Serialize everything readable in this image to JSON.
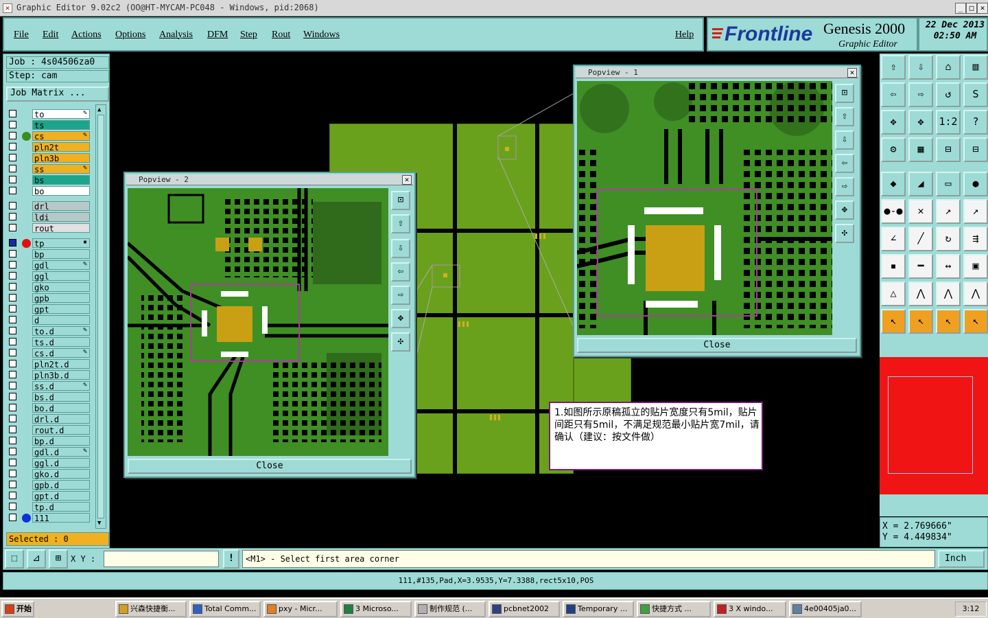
{
  "window": {
    "title": "Graphic Editor 9.02c2 (OO@HT-MYCAM-PC048 - Windows, pid:2068)"
  },
  "menu": {
    "items": [
      "File",
      "Edit",
      "Actions",
      "Options",
      "Analysis",
      "DFM",
      "Step",
      "Rout",
      "Windows"
    ],
    "help": "Help"
  },
  "brand": {
    "logo": "Frontline",
    "product": "Genesis 2000",
    "subtitle": "Graphic Editor"
  },
  "datetime": {
    "date": "22 Dec 2013",
    "time": "02:50 AM"
  },
  "job": {
    "job": "Job : 4s04506za0",
    "step": "Step: cam",
    "matrix_button": "Job Matrix ..."
  },
  "layers": [
    {
      "name": "to",
      "color": "#ffffff",
      "mark": "✎"
    },
    {
      "name": "ts",
      "color": "#1aa58c",
      "mark": ""
    },
    {
      "name": "cs",
      "color": "#f0b020",
      "mark": "✎",
      "dot": "#3c8c1c"
    },
    {
      "name": "pln2t",
      "color": "#f0b020",
      "mark": ""
    },
    {
      "name": "pln3b",
      "color": "#f0b020",
      "mark": ""
    },
    {
      "name": "ss",
      "color": "#f0b020",
      "mark": "✎"
    },
    {
      "name": "bs",
      "color": "#1aa58c",
      "mark": ""
    },
    {
      "name": "bo",
      "color": "#ffffff",
      "mark": ""
    },
    {
      "name": "drl",
      "color": "#b8c8c8",
      "mark": "",
      "gap": true
    },
    {
      "name": "ldi",
      "color": "#b8c8c8",
      "mark": ""
    },
    {
      "name": "rout",
      "color": "#e0e0e0",
      "mark": ""
    },
    {
      "name": "tp",
      "color": "#9edbd6",
      "mark": "▪",
      "gap": true,
      "dot": "#e01010",
      "checked": true
    },
    {
      "name": "bp",
      "color": "#9edbd6",
      "mark": ""
    },
    {
      "name": "gdl",
      "color": "#9edbd6",
      "mark": "✎"
    },
    {
      "name": "ggl",
      "color": "#9edbd6",
      "mark": ""
    },
    {
      "name": "gko",
      "color": "#9edbd6",
      "mark": ""
    },
    {
      "name": "gpb",
      "color": "#9edbd6",
      "mark": ""
    },
    {
      "name": "gpt",
      "color": "#9edbd6",
      "mark": ""
    },
    {
      "name": "d",
      "color": "#9edbd6",
      "mark": ""
    },
    {
      "name": "to.d",
      "color": "#9edbd6",
      "mark": "✎"
    },
    {
      "name": "ts.d",
      "color": "#9edbd6",
      "mark": ""
    },
    {
      "name": "cs.d",
      "color": "#9edbd6",
      "mark": "✎"
    },
    {
      "name": "pln2t.d",
      "color": "#9edbd6",
      "mark": ""
    },
    {
      "name": "pln3b.d",
      "color": "#9edbd6",
      "mark": ""
    },
    {
      "name": "ss.d",
      "color": "#9edbd6",
      "mark": "✎"
    },
    {
      "name": "bs.d",
      "color": "#9edbd6",
      "mark": ""
    },
    {
      "name": "bo.d",
      "color": "#9edbd6",
      "mark": ""
    },
    {
      "name": "drl.d",
      "color": "#9edbd6",
      "mark": ""
    },
    {
      "name": "rout.d",
      "color": "#9edbd6",
      "mark": ""
    },
    {
      "name": "bp.d",
      "color": "#9edbd6",
      "mark": ""
    },
    {
      "name": "gdl.d",
      "color": "#9edbd6",
      "mark": "✎"
    },
    {
      "name": "ggl.d",
      "color": "#9edbd6",
      "mark": ""
    },
    {
      "name": "gko.d",
      "color": "#9edbd6",
      "mark": ""
    },
    {
      "name": "gpb.d",
      "color": "#9edbd6",
      "mark": ""
    },
    {
      "name": "gpt.d",
      "color": "#9edbd6",
      "mark": ""
    },
    {
      "name": "tp.d",
      "color": "#9edbd6",
      "mark": ""
    },
    {
      "name": "111",
      "color": "#9edbd6",
      "mark": "",
      "dot": "#1030e0"
    }
  ],
  "selected": "Selected : 0",
  "popup1": {
    "title": "Popview - 1",
    "close": "Close"
  },
  "popup2": {
    "title": "Popview - 2",
    "close": "Close"
  },
  "note": {
    "text": "1.如图所示原稿孤立的贴片宽度只有5mil，贴片间距只有5mil，不满足规范最小贴片宽7mil，请确认（建议：按文件做）"
  },
  "coords": {
    "x": "X = 2.769666\"",
    "y": "Y = 4.449834\""
  },
  "cmd": {
    "xy_label": "X Y :",
    "prompt": "<M1> - Select first area corner",
    "units": "Inch"
  },
  "status": "111,#135,Pad,X=3.9535,Y=7.3388,rect5x10,POS",
  "taskbar": {
    "start": "开始",
    "items": [
      "兴森快捷衡...",
      "Total Comm...",
      "pxy - Micr...",
      "3 Microso...",
      "制作规范 (...",
      "pcbnet2002",
      "Temporary ...",
      "快捷方式 ...",
      "3 X windo...",
      "4e00405ja0..."
    ],
    "clock": "3:12"
  },
  "tools": [
    "⇧",
    "⇩",
    "⌂",
    "▥",
    "⇦",
    "⇨",
    "↺",
    "S",
    "✥",
    "✥",
    "1:2",
    "?",
    "⚙",
    "▦",
    "⊟",
    "⊟",
    "◆",
    "◢",
    "▭",
    "●",
    "●-●",
    "✕",
    "↗",
    "↗",
    "∠",
    "╱",
    "↻",
    "⇶",
    "▪",
    "━",
    "↔",
    "▣",
    "△",
    "⋀",
    "⋀",
    "⋀",
    "↖",
    "↖",
    "↖",
    "↖"
  ]
}
